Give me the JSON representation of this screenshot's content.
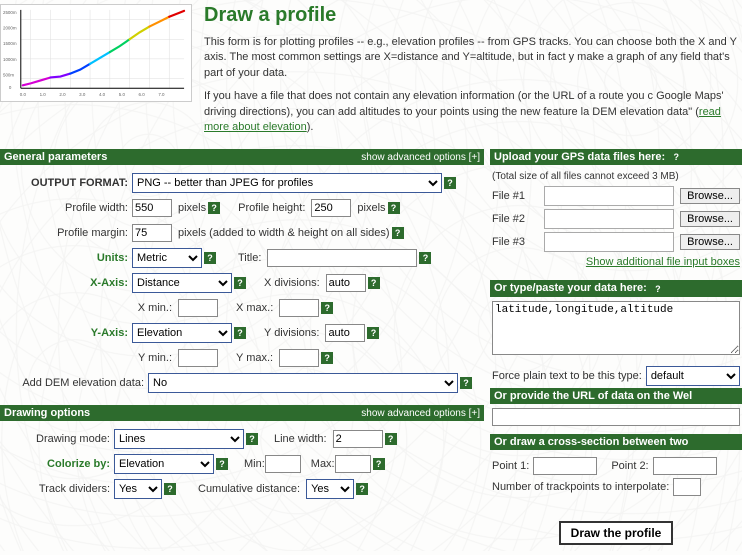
{
  "header": {
    "title": "Draw a profile",
    "para1": "This form is for plotting profiles -- e.g., elevation profiles -- from GPS tracks. You can choose both the X and Y axis. The most common settings are X=distance and Y=altitude, but in fact y make a graph of any field that's part of your data.",
    "para2a": "If you have a file that does not contain any elevation information (or the URL of a route you c Google Maps' driving directions), you can add altitudes to your points using the new feature la DEM elevation data\" (",
    "linkElev": "read more about elevation",
    "para2b": ")."
  },
  "general": {
    "title": "General parameters",
    "adv": "show advanced options [+]",
    "output_label": "OUTPUT FORMAT:",
    "output_value": "PNG -- better than JPEG for profiles",
    "width_label": "Profile width:",
    "width_value": "550",
    "height_label": "Profile height:",
    "height_value": "250",
    "pixels": "pixels",
    "margin_label": "Profile margin:",
    "margin_value": "75",
    "margin_note": "pixels (added to width & height on all sides)",
    "units_label": "Units:",
    "units_value": "Metric",
    "title_label": "Title:",
    "title_value": "",
    "xaxis_label": "X-Axis:",
    "xaxis_value": "Distance",
    "xdiv_label": "X divisions:",
    "xdiv_value": "auto",
    "xmin_label": "X min.:",
    "xmin_value": "",
    "xmax_label": "X max.:",
    "xmax_value": "",
    "yaxis_label": "Y-Axis:",
    "yaxis_value": "Elevation",
    "ydiv_label": "Y divisions:",
    "ydiv_value": "auto",
    "ymin_label": "Y min.:",
    "ymin_value": "",
    "ymax_label": "Y max.:",
    "ymax_value": "",
    "dem_label": "Add DEM elevation data:",
    "dem_value": "No"
  },
  "drawing": {
    "title": "Drawing options",
    "adv": "show advanced options [+]",
    "mode_label": "Drawing mode:",
    "mode_value": "Lines",
    "linew_label": "Line width:",
    "linew_value": "2",
    "colorize_label": "Colorize by:",
    "colorize_value": "Elevation",
    "min_label": "Min:",
    "min_value": "",
    "max_label": "Max:",
    "max_value": "",
    "dividers_label": "Track dividers:",
    "dividers_value": "Yes",
    "cumdist_label": "Cumulative distance:",
    "cumdist_value": "Yes"
  },
  "upload": {
    "title": "Upload your GPS data files here:",
    "subtext": "(Total size of all files cannot exceed 3 MB)",
    "file1": "File #1",
    "file2": "File #2",
    "file3": "File #3",
    "browse": "Browse...",
    "more": "Show additional file input boxes"
  },
  "paste": {
    "title": "Or type/paste your data here:",
    "placeholder": "latitude,longitude,altitude",
    "force_label": "Force plain text to be this type:",
    "force_value": "default"
  },
  "url": {
    "title": "Or provide the URL of data on the Wel",
    "value": ""
  },
  "cross": {
    "title": "Or draw a cross-section between two",
    "p1_label": "Point 1:",
    "p1_value": "",
    "p2_label": "Point 2:",
    "p2_value": "",
    "ntrk_label": "Number of trackpoints to interpolate:",
    "ntrk_value": ""
  },
  "submit": "Draw the profile",
  "chart_data": {
    "type": "line",
    "title": "",
    "xlabel": "",
    "ylabel": "",
    "xlim": [
      0,
      7.5
    ],
    "ylim": [
      0,
      2500
    ],
    "x": [
      0.0,
      0.5,
      1.0,
      1.5,
      2.0,
      2.5,
      3.0,
      3.5,
      4.0,
      4.5,
      5.0,
      5.5,
      6.0,
      6.5,
      7.0,
      7.5
    ],
    "values": [
      120,
      180,
      320,
      400,
      450,
      520,
      680,
      820,
      980,
      1150,
      1350,
      1550,
      1750,
      1950,
      2150,
      2350
    ]
  }
}
